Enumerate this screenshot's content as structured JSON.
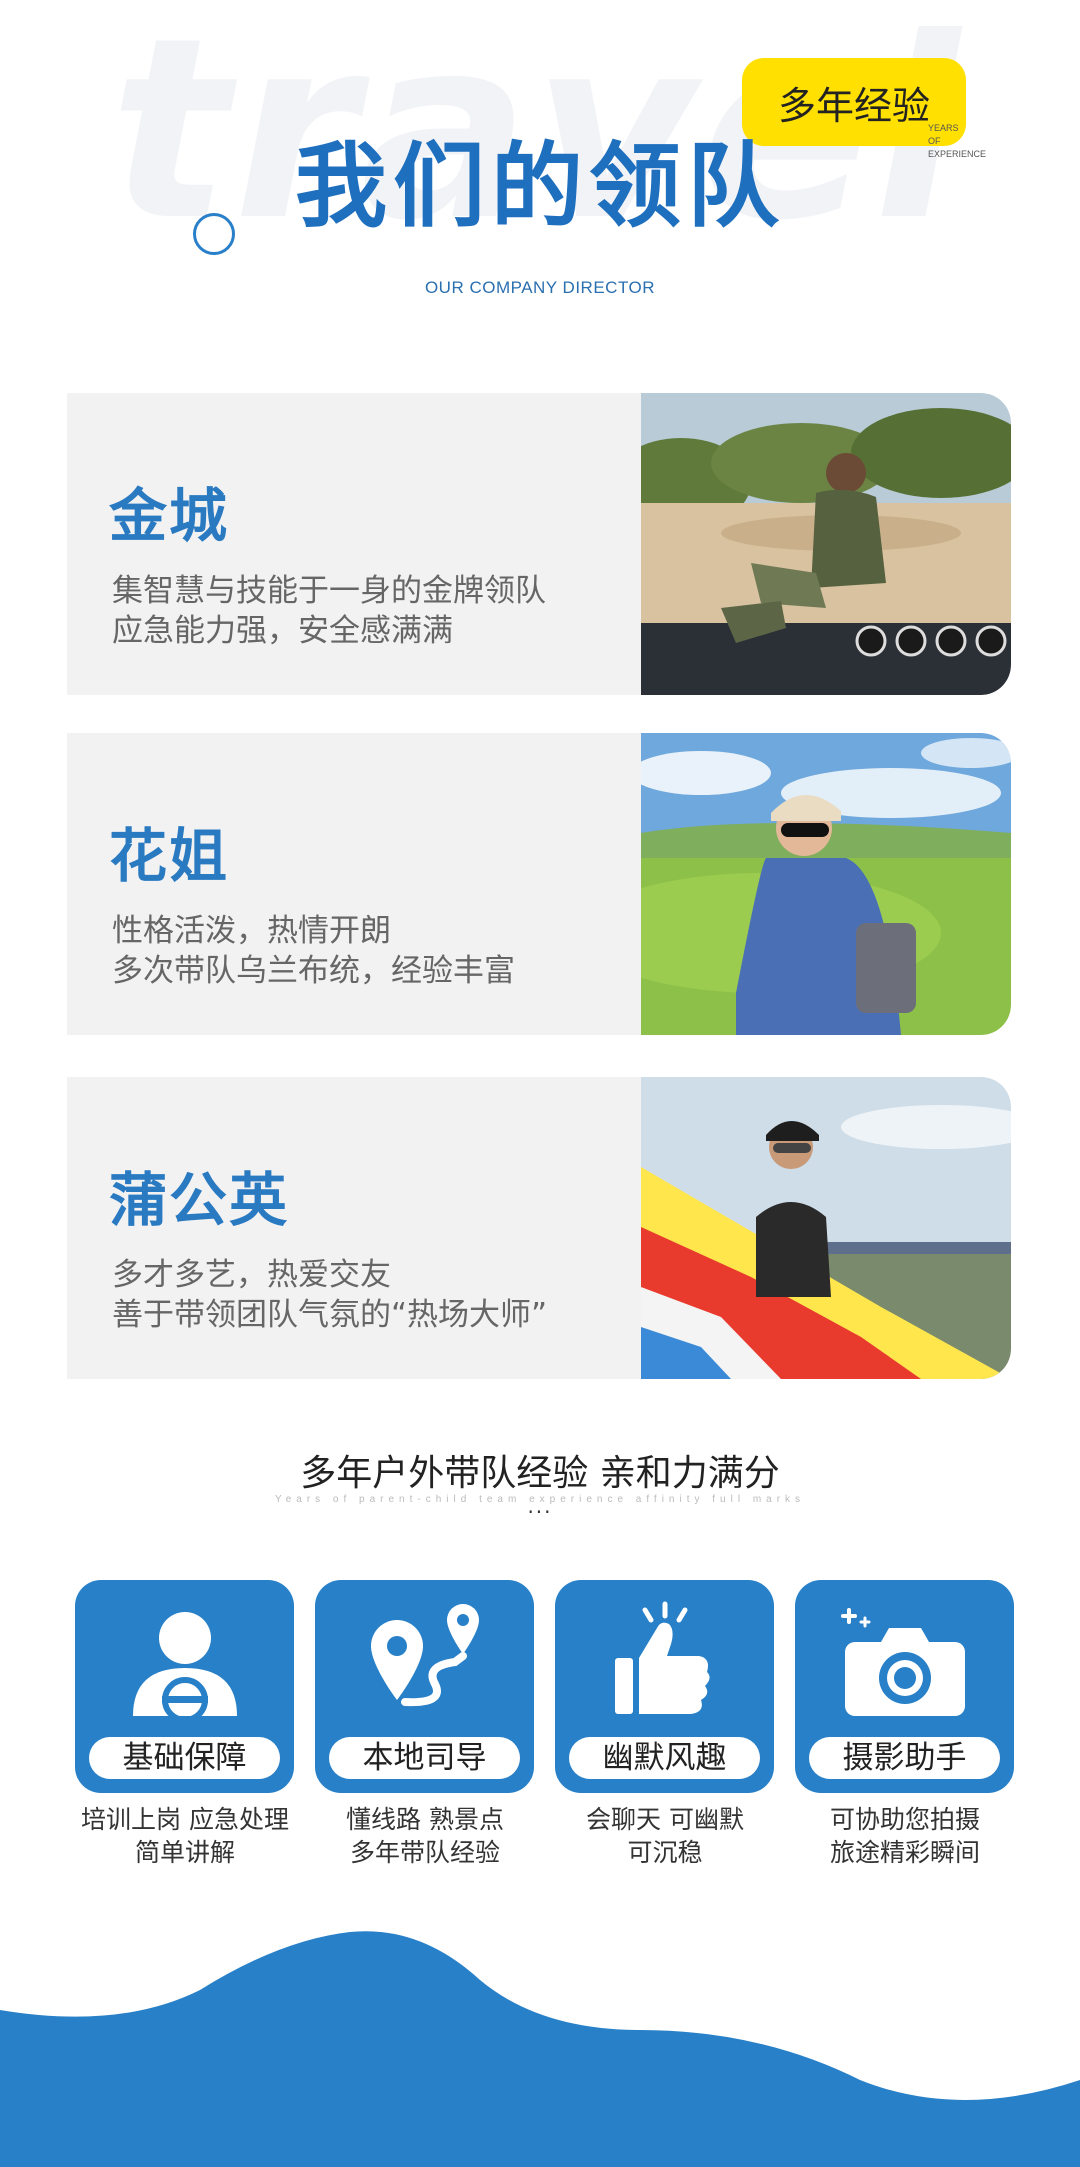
{
  "header": {
    "bg_word": "travel",
    "badge": "多年经验",
    "badge_sub": [
      "YEARS",
      "OF",
      "EXPERIENCE"
    ],
    "title": "我们的领队",
    "subtitle": "OUR COMPANY DIRECTOR"
  },
  "leaders": [
    {
      "name": "金城",
      "lines": [
        "集智慧与技能于一身的金牌领队",
        "应急能力强，安全感满满"
      ]
    },
    {
      "name": "花姐",
      "lines": [
        "性格活泼，热情开朗",
        "多次带队乌兰布统，经验丰富"
      ]
    },
    {
      "name": "蒲公英",
      "lines": [
        "多才多艺，热爱交友",
        "善于带领团队气氛的“热场大师”"
      ]
    }
  ],
  "section2": {
    "title": "多年户外带队经验 亲和力满分",
    "subtitle": "Years of parent-child team experience affinity full marks",
    "dots": "···"
  },
  "features": [
    {
      "label": "基础保障",
      "icon": "driver-icon",
      "lines": [
        "培训上岗 应急处理",
        "简单讲解"
      ]
    },
    {
      "label": "本地司导",
      "icon": "map-route-icon",
      "lines": [
        "懂线路 熟景点",
        "多年带队经验"
      ]
    },
    {
      "label": "幽默风趣",
      "icon": "thumbs-up-icon",
      "lines": [
        "会聊天 可幽默",
        "可沉稳"
      ]
    },
    {
      "label": "摄影助手",
      "icon": "camera-icon",
      "lines": [
        "可协助您拍摄",
        "旅途精彩瞬间"
      ]
    }
  ],
  "colors": {
    "primary": "#2880c8",
    "title_blue": "#1f6fbf",
    "badge": "#ffe000",
    "card_bg": "#f2f2f2"
  }
}
